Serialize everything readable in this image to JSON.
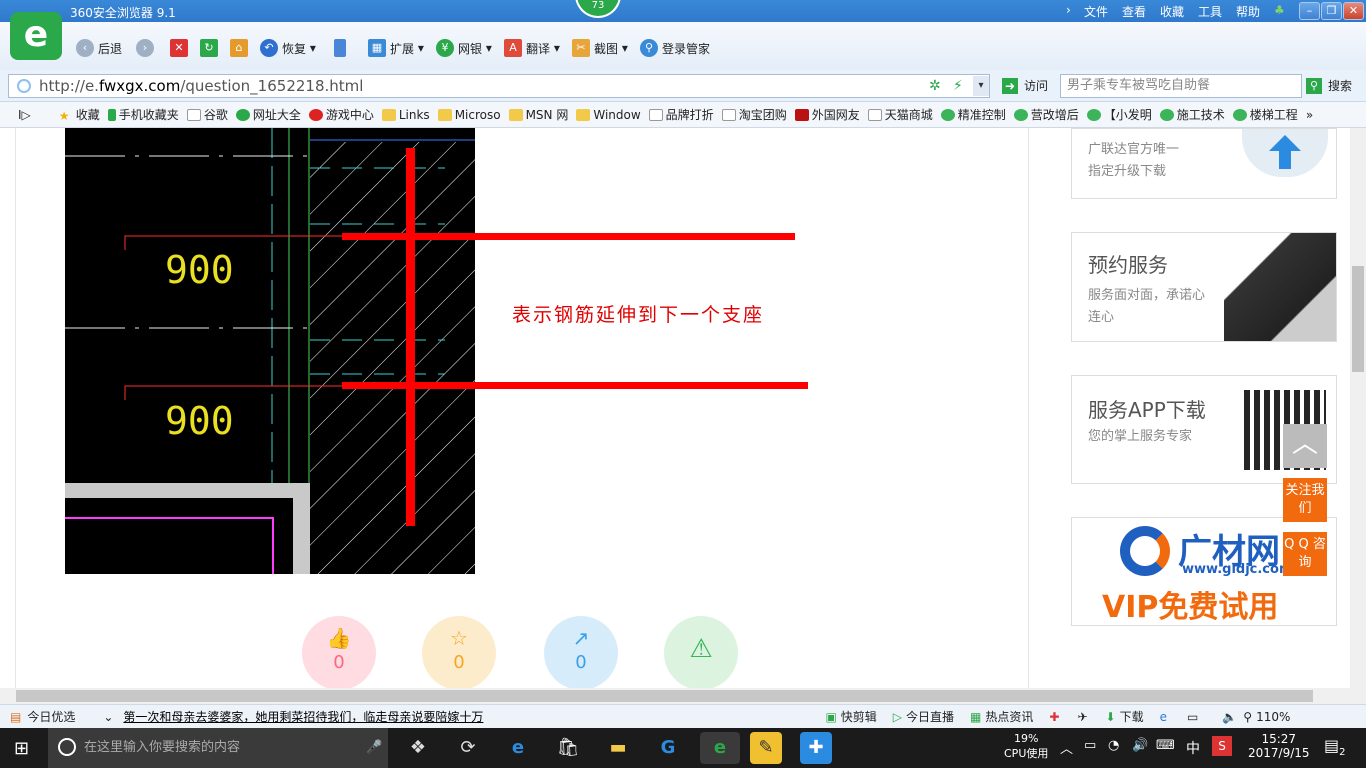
{
  "window": {
    "title": "360安全浏览器 9.1",
    "badge": "73"
  },
  "menu": [
    "文件",
    "查看",
    "收藏",
    "工具",
    "帮助"
  ],
  "toolbar": {
    "back": "后退",
    "restore": "恢复",
    "extend": "扩展",
    "bank": "网银",
    "translate": "翻译",
    "screenshot": "截图",
    "login": "登录管家"
  },
  "address": {
    "url_prefix": "http://e.",
    "url_host": "fwxgx.com",
    "url_path": "/question_1652218.html",
    "visit": "访问",
    "search_placeholder": "男子乘专车被骂吃自助餐",
    "search_btn": "搜索"
  },
  "favorites": [
    "收藏",
    "手机收藏夹",
    "谷歌",
    "网址大全",
    "游戏中心",
    "Links",
    "Microso",
    "MSN 网",
    "Window",
    "品牌打折",
    "淘宝团购",
    "外国网友",
    "天猫商城",
    "精准控制",
    "营改增后",
    "【小发明",
    "施工技术",
    "楼梯工程"
  ],
  "drawing": {
    "label_top": "900",
    "label_bottom": "900"
  },
  "annotation": "表示钢筋延伸到下一个支座",
  "actions": [
    {
      "icon": "thumbs-up",
      "count": "0",
      "color": "#ffd9df",
      "fg": "#ff5577"
    },
    {
      "icon": "star",
      "count": "0",
      "color": "#fdeccc",
      "fg": "#f5a623"
    },
    {
      "icon": "share",
      "count": "0",
      "color": "#d6ecfb",
      "fg": "#3aa0e8"
    },
    {
      "icon": "warning",
      "count": "",
      "color": "#dcf3e0",
      "fg": "#3bb45a"
    }
  ],
  "sidebar": {
    "ad1": {
      "line1": "广联达官方唯一",
      "line2": "指定升级下载"
    },
    "ad2": {
      "title": "预约服务",
      "desc": "服务面对面，承诺心连心"
    },
    "ad3": {
      "title": "服务APP下载",
      "desc": "您的掌上服务专家"
    },
    "ad4": {
      "brand": "广材网",
      "url": "www.gldjc.com",
      "promo": "VIP免费试用"
    }
  },
  "float": {
    "follow": "关注我们",
    "qq": "Q Q 咨询"
  },
  "status": {
    "today": "今日优选",
    "headline": "第一次和母亲去婆婆家，她用剩菜招待我们，临走母亲说要陪嫁十万",
    "clip": "快剪辑",
    "live": "今日直播",
    "news": "热点资讯",
    "download": "下载",
    "zoom": "110%"
  },
  "taskbar": {
    "search_placeholder": "在这里输入你要搜索的内容",
    "cpu": "19%",
    "cpu_label": "CPU使用",
    "ime": "中",
    "time": "15:27",
    "date": "2017/9/15",
    "notify": "2"
  }
}
